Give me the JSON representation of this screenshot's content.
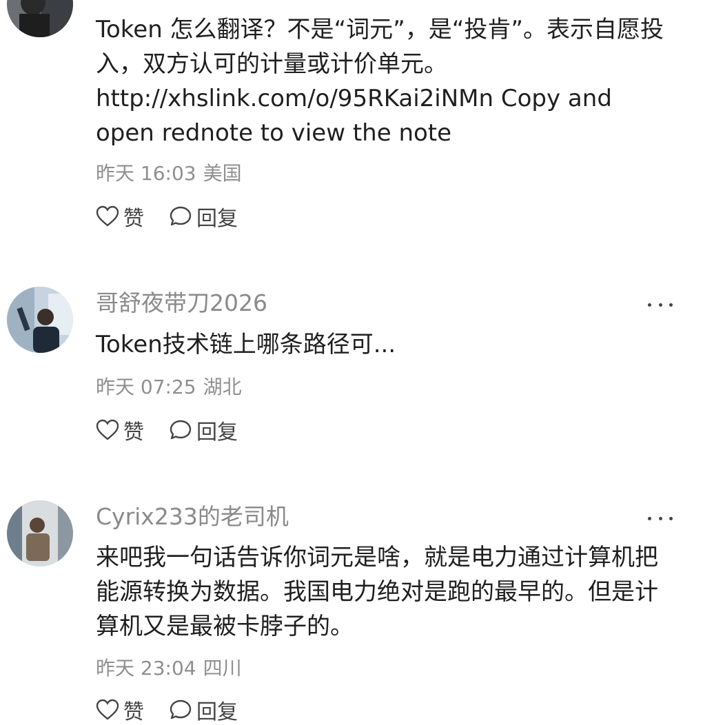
{
  "comments": [
    {
      "author": "",
      "content_lines": [
        "Token 怎么翻译？不是“词元”，是“投肯”。表示自愿投",
        "入，双方认可的计量或计价单元。",
        "http://xhslink.com/o/95RKai2iNMn Copy and",
        "open rednote to view the note"
      ],
      "date": "昨天 16:03",
      "location": "美国",
      "like_label": "赞",
      "reply_label": "回复"
    },
    {
      "author": "哥舒夜带刀2026",
      "content_lines": [
        "Token技术链上哪条路径可..."
      ],
      "date": "昨天 07:25",
      "location": "湖北",
      "like_label": "赞",
      "reply_label": "回复"
    },
    {
      "author": "Cyrix233的老司机",
      "content_lines": [
        "来吧我一句话告诉你词元是啥，就是电力通过计算机把",
        "能源转换为数据。我国电力绝对是跑的最早的。但是计",
        "算机又是最被卡脖子的。"
      ],
      "date": "昨天 23:04",
      "location": "四川",
      "like_label": "赞",
      "reply_label": "回复"
    }
  ],
  "icons": {
    "like": "heart-outline-icon",
    "reply": "speech-bubble-icon",
    "more": "ellipsis-icon"
  },
  "colors": {
    "author": "#8a8a8a",
    "meta": "#8f8f8f",
    "text": "#1f1f1f"
  }
}
